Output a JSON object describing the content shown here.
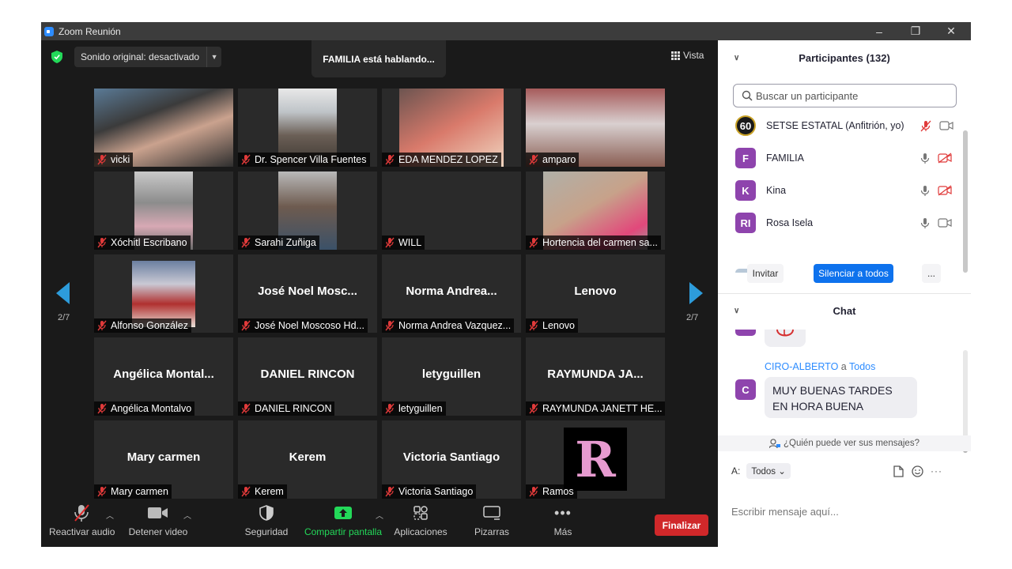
{
  "window": {
    "title": "Zoom Reunión",
    "controls": [
      "–",
      "❐",
      "✕"
    ]
  },
  "top_bar": {
    "sound_label": "Sonido original: desactivado",
    "speaking": "FAMILIA está hablando...",
    "view_label": "Vista"
  },
  "gallery": {
    "page_left": "2/7",
    "page_right": "2/7",
    "tiles": [
      {
        "center": "",
        "label": "vicki"
      },
      {
        "center": "",
        "label": "Dr. Spencer Villa Fuentes"
      },
      {
        "center": "",
        "label": "EDA MENDEZ  LOPEZ"
      },
      {
        "center": "",
        "label": "amparo"
      },
      {
        "center": "",
        "label": "Xóchitl Escribano"
      },
      {
        "center": "",
        "label": "Sarahi Zuñiga"
      },
      {
        "center": "",
        "label": "WILL"
      },
      {
        "center": "",
        "label": "Hortencia del carmen sa..."
      },
      {
        "center": "",
        "label": "Alfonso González"
      },
      {
        "center": "José  Noel  Mosc...",
        "label": "José Noel Moscoso Hd..."
      },
      {
        "center": "Norma  Andrea...",
        "label": "Norma Andrea Vazquez..."
      },
      {
        "center": "Lenovo",
        "label": "Lenovo"
      },
      {
        "center": "Angélica  Montal...",
        "label": "Angélica Montalvo"
      },
      {
        "center": "DANIEL RINCON",
        "label": "DANIEL RINCON"
      },
      {
        "center": "letyguillen",
        "label": "letyguillen"
      },
      {
        "center": "RAYMUNDA  JA...",
        "label": "RAYMUNDA JANETT  HE..."
      },
      {
        "center": "Mary carmen",
        "label": "Mary carmen"
      },
      {
        "center": "Kerem",
        "label": "Kerem"
      },
      {
        "center": "Victoria Santiago",
        "label": "Victoria Santiago"
      },
      {
        "center": "",
        "label": "Ramos"
      }
    ],
    "ramos_letter": "R"
  },
  "toolbar": {
    "unmute": "Reactivar audio",
    "stop_video": "Detener video",
    "security": "Seguridad",
    "share": "Compartir pantalla",
    "apps": "Aplicaciones",
    "whiteboards": "Pizarras",
    "more": "Más",
    "end": "Finalizar"
  },
  "participants": {
    "header": "Participantes (132)",
    "search_placeholder": "Buscar un participante",
    "list": [
      {
        "avatar": "60",
        "name": "SETSE ESTATAL (Anfitrión, yo)",
        "color": "#1a1a1a"
      },
      {
        "avatar": "F",
        "name": "FAMILIA",
        "color": "#8e44ad"
      },
      {
        "avatar": "K",
        "name": "Kina",
        "color": "#8e44ad"
      },
      {
        "avatar": "RI",
        "name": "Rosa Isela",
        "color": "#8e44ad"
      }
    ],
    "invite": "Invitar",
    "mute_all": "Silenciar a todos",
    "more": "..."
  },
  "chat": {
    "header": "Chat",
    "sender": "CIRO-ALBERTO",
    "to_word": "a",
    "recipient": "Todos",
    "sender_avatar": "C",
    "message": "MUY BUENAS TARDES EN HORA BUENA",
    "who_can_see": "¿Quién puede ver sus mensajes?",
    "to_label": "A:",
    "to_value": "Todos",
    "input_placeholder": "Escribir mensaje aquí..."
  },
  "colors": {
    "accent": "#2d8cff",
    "share_green": "#23d959",
    "end_red": "#d0282a",
    "avatar_purple": "#8e44ad"
  }
}
